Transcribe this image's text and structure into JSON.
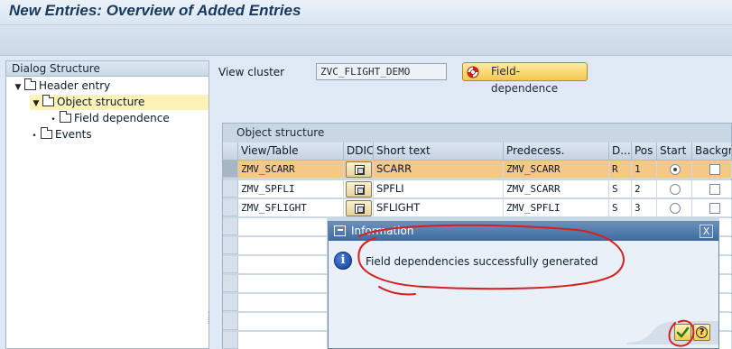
{
  "title": "New Entries: Overview of Added Entries",
  "dialog_structure": {
    "header": "Dialog Structure",
    "nodes": [
      {
        "label": "Header entry",
        "mark": "▼",
        "level": 0
      },
      {
        "label": "Object structure",
        "mark": "▼",
        "level": 1
      },
      {
        "label": "Field dependence",
        "mark": "•",
        "level": 2
      },
      {
        "label": "Events",
        "mark": "•",
        "level": 1
      }
    ]
  },
  "view_cluster": {
    "label": "View cluster",
    "value": "ZVC_FLIGHT_DEMO",
    "button_label": "Field-dependence"
  },
  "object_structure": {
    "title": "Object structure",
    "columns": [
      "View/Table",
      "DDIC",
      "Short text",
      "Predecess.",
      "D...",
      "Pos",
      "Start",
      "Backgr"
    ],
    "rows": [
      {
        "view": "ZMV_SCARR",
        "short_text": "SCARR",
        "predecessor": "ZMV_SCARR",
        "d": "R",
        "pos": "1",
        "start": true,
        "backgr": false
      },
      {
        "view": "ZMV_SPFLI",
        "short_text": "SPFLI",
        "predecessor": "ZMV_SCARR",
        "d": "S",
        "pos": "2",
        "start": false,
        "backgr": false
      },
      {
        "view": "ZMV_SFLIGHT",
        "short_text": "SFLIGHT",
        "predecessor": "ZMV_SPFLI",
        "d": "S",
        "pos": "3",
        "start": false,
        "backgr": false
      }
    ]
  },
  "dialog": {
    "title": "Information",
    "info_glyph": "i",
    "message": "Field dependencies successfully generated",
    "close_glyph": "X",
    "help_glyph": "?",
    "ok_glyph": "✔"
  },
  "icons": {
    "folder": "folder-icon",
    "lifebuoy": "lifebuoy-icon",
    "info": "info-icon",
    "ok": "checkmark-icon",
    "help": "help-icon",
    "close": "close-icon"
  },
  "colors": {
    "selected_row": "#f5c88a",
    "selected_tree_node": "#fdf2b8",
    "dialog_titlebar": "#3f6b9f",
    "annotation": "#d61f1f"
  }
}
